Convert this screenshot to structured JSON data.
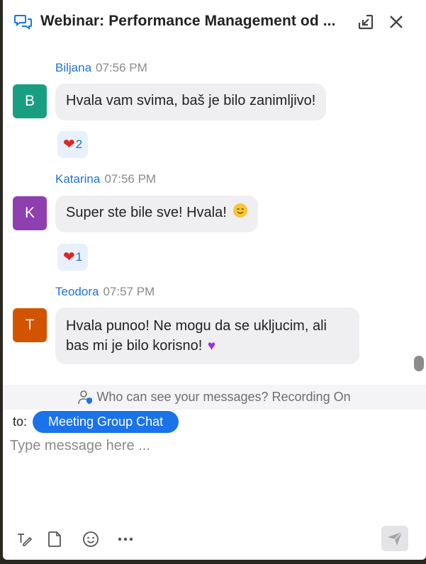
{
  "header": {
    "title": "Webinar: Performance Management od ...",
    "chat_icon": "chat-bubbles-icon",
    "popout_icon": "popout-icon",
    "close_icon": "close-icon"
  },
  "messages": [
    {
      "sender": "Biljana",
      "time": "07:56 PM",
      "initial": "B",
      "avatar_color": "#1a9e82",
      "text": "Hvala vam svima, baš je bilo zanimljivo!",
      "reaction": {
        "emoji": "heart-icon",
        "count": "2"
      }
    },
    {
      "sender": "Katarina",
      "time": "07:56 PM",
      "initial": "K",
      "avatar_color": "#8e3fb0",
      "text": "Super ste bile sve! Hvala!",
      "emoji": "smiling-face-icon",
      "reaction": {
        "emoji": "heart-icon",
        "count": "1"
      }
    },
    {
      "sender": "Teodora",
      "time": "07:57 PM",
      "initial": "T",
      "avatar_color": "#d35400",
      "text_line1": "Hvala punoo! Ne mogu da se ukljucim, ali",
      "text_line2": "bas mi je bilo korisno!",
      "emoji": "purple-heart-icon"
    }
  ],
  "notice": {
    "text": "Who can see your messages? Recording On",
    "icon": "user-shield-icon"
  },
  "composer": {
    "to_label": "to:",
    "recipient": "Meeting Group Chat",
    "placeholder": "Type message here ...",
    "tools": [
      "format-icon",
      "file-icon",
      "emoji-icon",
      "more-icon"
    ],
    "send_icon": "send-icon"
  },
  "colors": {
    "accent": "#1a73e8",
    "link": "#2072d6",
    "bubble": "#efeff2"
  }
}
